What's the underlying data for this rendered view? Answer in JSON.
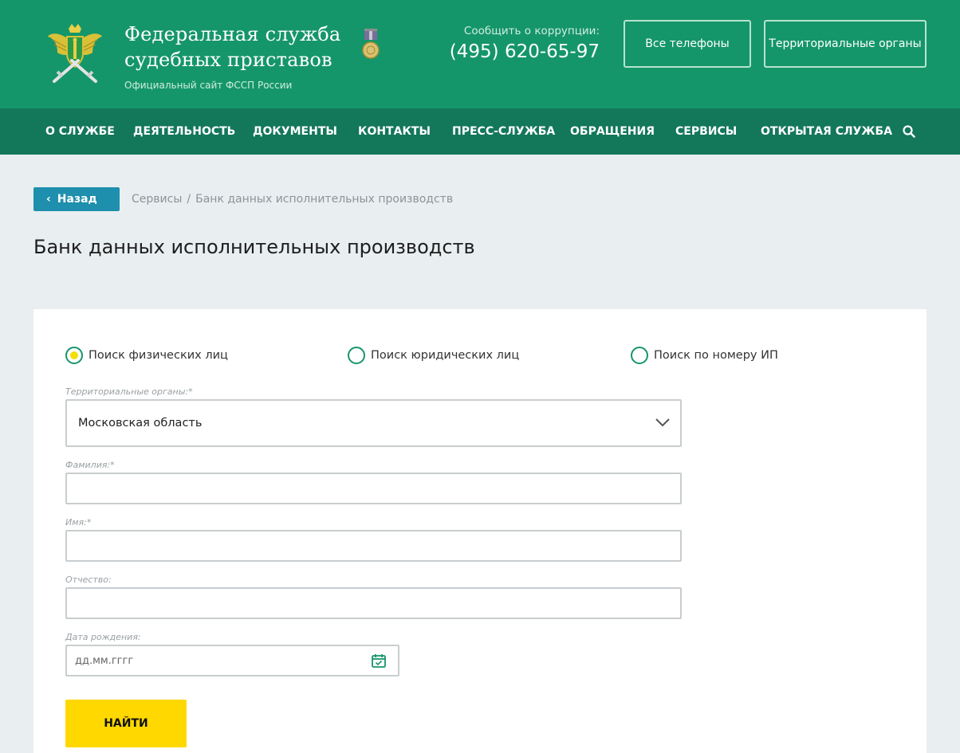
{
  "header": {
    "title": "Федеральная служба судебных приставов",
    "subtitle": "Официальный сайт ФССП России",
    "corruption_label": "Сообщить о коррупции:",
    "corruption_phone": "(495) 620-65-97",
    "btn_phones": "Все телефоны",
    "btn_territorial": "Территориальные органы",
    "logo_icon": "fssp-emblem-icon",
    "medal_icon": "medal-icon"
  },
  "nav": {
    "items": [
      {
        "label": "О СЛУЖБЕ"
      },
      {
        "label": "ДЕЯТЕЛЬНОСТЬ"
      },
      {
        "label": "ДОКУМЕНТЫ"
      },
      {
        "label": "КОНТАКТЫ"
      },
      {
        "label": "ПРЕСС-СЛУЖБА"
      },
      {
        "label": "ОБРАЩЕНИЯ"
      },
      {
        "label": "СЕРВИСЫ"
      },
      {
        "label": "ОТКРЫТАЯ СЛУЖБА"
      }
    ],
    "search_icon": "search-icon"
  },
  "breadcrumb": {
    "back_label": "Назад",
    "items": [
      "Сервисы",
      "Банк данных исполнительных производств"
    ],
    "separator": "/"
  },
  "page": {
    "title": "Банк данных исполнительных производств"
  },
  "form": {
    "search_types": [
      {
        "label": "Поиск физических лиц",
        "checked": true
      },
      {
        "label": "Поиск юридических лиц",
        "checked": false
      },
      {
        "label": "Поиск по номеру ИП",
        "checked": false
      }
    ],
    "territorial_label": "Территориальные органы:*",
    "territorial_value": "Московская область",
    "lastname_label": "Фамилия:*",
    "lastname_value": "",
    "firstname_label": "Имя:*",
    "firstname_value": "",
    "patronymic_label": "Отчество:",
    "patronymic_value": "",
    "birthdate_label": "Дата рождения:",
    "birthdate_placeholder": "дд.мм.гггг",
    "submit_label": "НАЙТИ"
  },
  "colors": {
    "header_bg": "#15966a",
    "nav_bg": "#13775a",
    "back_button": "#1f8fae",
    "submit_button": "#ffd800",
    "radio_checked": "#f2e000"
  }
}
